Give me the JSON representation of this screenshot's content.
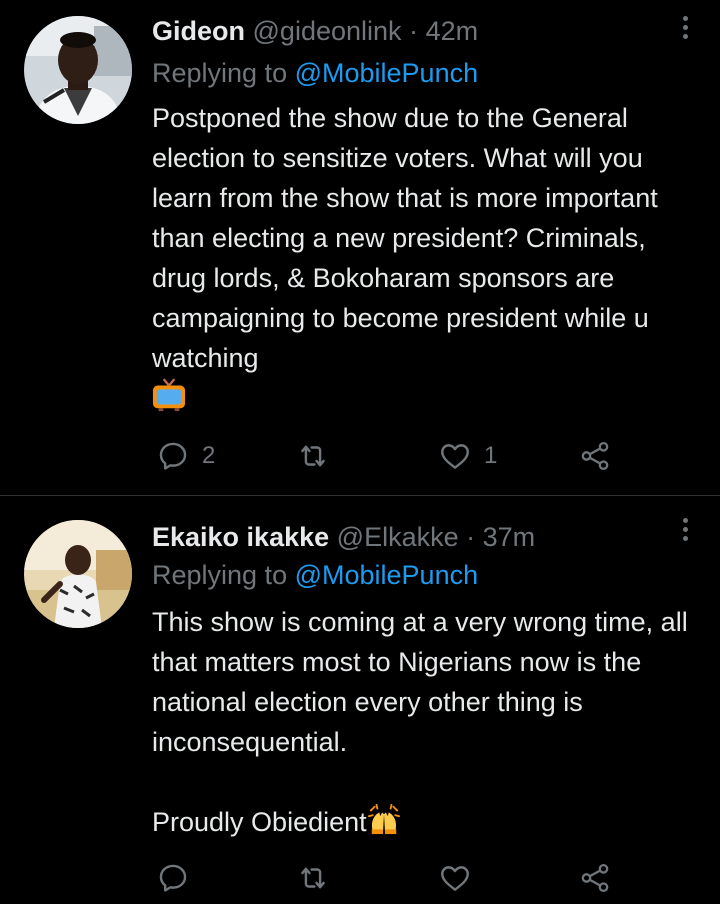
{
  "tweets": [
    {
      "name": "Gideon",
      "handle": "@gideonlink",
      "separator": "·",
      "time": "42m",
      "replying_prefix": "Replying to ",
      "replying_to": "@MobilePunch",
      "text": "Postponed the show due to the General election to sensitize voters. What will you learn from the show that is more important than electing a new president? Criminals, drug lords, & Bokoharam sponsors are campaigning to become president while u watching",
      "emoji": "television",
      "reply_count": "2",
      "retweet_count": "",
      "like_count": "1"
    },
    {
      "name": "Ekaiko ikakke",
      "handle": "@Elkakke",
      "separator": "·",
      "time": "37m",
      "replying_prefix": "Replying to ",
      "replying_to": "@MobilePunch",
      "text": "This show is coming at a very wrong time, all that matters most to Nigerians now is the national election every other thing is inconsequential.\n\nProudly Obiedient",
      "emoji": "raising-hands",
      "reply_count": "",
      "retweet_count": "",
      "like_count": ""
    }
  ],
  "colors": {
    "background": "#000000",
    "text": "#e7e9ea",
    "secondary": "#71767b",
    "link": "#1d9bf0",
    "divider": "#2f3336"
  },
  "icons": {
    "reply": "reply-icon",
    "retweet": "retweet-icon",
    "like": "heart-icon",
    "share": "share-icon",
    "more": "more-icon"
  }
}
